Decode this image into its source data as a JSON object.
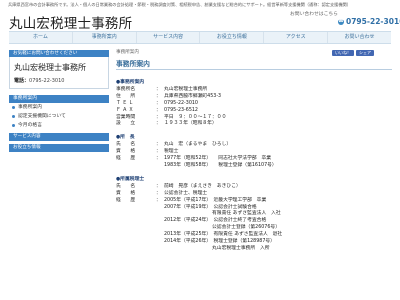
{
  "top_tagline": "兵庫県西宮市の会計事務所です。法人・個人の日常業務の会計処理・節税・税務調査対策、相続税申告、創業支援など総合的にサポート。経営革新等支援機関（通称：認定支援機関）",
  "header": {
    "title": "丸山宏税理士事務所",
    "contact_line": "お問い合わせはこちら",
    "tel_icon": "phone-icon",
    "tel": "0795-22-3010"
  },
  "nav": [
    {
      "label": "ホーム"
    },
    {
      "label": "事務所案内"
    },
    {
      "label": "サービス内容"
    },
    {
      "label": "お役立ち情報"
    },
    {
      "label": "アクセス"
    },
    {
      "label": "お問い合わせ"
    }
  ],
  "sidebar": {
    "notice": "お気軽にお問い合わせください",
    "office_name": "丸山宏税理士事務所",
    "tel_label": "電話：",
    "tel": "0795-22-3010",
    "menu_head": "事務所案内",
    "menu_items": [
      {
        "label": "事務所案内"
      },
      {
        "label": "認定支援機関について"
      },
      {
        "label": "今月の格言"
      }
    ],
    "sub_heads": [
      {
        "label": "サービス内容"
      },
      {
        "label": "お役立ち情報"
      }
    ]
  },
  "main": {
    "breadcrumb": "事務所案内",
    "fb_like": "いいね！",
    "fb_share": "シェア",
    "page_title": "事務所案内",
    "office_section": {
      "title": "●事務所案内",
      "rows": [
        {
          "label": "事務所名",
          "value": "丸山宏税理士事務所"
        },
        {
          "label": "住　　所",
          "value": "兵庫県西脇市郷瀬町453-3"
        },
        {
          "label": "Ｔ Ｅ Ｌ",
          "value": "0795-22-3010"
        },
        {
          "label": "Ｆ Ａ Ｘ",
          "value": "0795-23-6512"
        },
        {
          "label": "営業時間",
          "value": "平日　９：００～１７：００"
        },
        {
          "label": "設　　立",
          "value": "１９３３年（昭和８年）"
        }
      ]
    },
    "owner_section": {
      "title": "●所　長",
      "rows": [
        {
          "label": "氏　　名",
          "value": "丸山　宏（まるやま　ひろし）"
        },
        {
          "label": "資　　格",
          "value": "税理士"
        },
        {
          "label": "経　　歴",
          "value": "1977年（昭和52年）　　同志社大学法学部　卒業"
        },
        {
          "label": "",
          "value": "1983年（昭和58年）　　税理士登録（第16107号）"
        }
      ]
    },
    "staff_section": {
      "title": "●所属税理士",
      "rows": [
        {
          "label": "氏　　名",
          "value": "前崎　晃彦（まえさき　あきひこ）"
        },
        {
          "label": "資　　格",
          "value": "公認会計士、税理士"
        },
        {
          "label": "経　　歴",
          "value": "2005年（平成17年）　近畿大学理工学部　卒業"
        },
        {
          "label": "",
          "value": "2007年（平成19年）　公認会計士試験合格"
        },
        {
          "label": "",
          "value": "　　　　　　　　　　有限責任 あずさ監査法人　入社"
        },
        {
          "label": "",
          "value": "2012年（平成24年）　公認会計士終了考査合格"
        },
        {
          "label": "",
          "value": "　　　　　　　　　　公認会計士登録（第26076号）"
        },
        {
          "label": "",
          "value": "2013年（平成25年）　有限責任 あずさ監査法人　退社"
        },
        {
          "label": "",
          "value": "2014年（平成26年）　税理士登録（第128987号）"
        },
        {
          "label": "",
          "value": "　　　　　　　　　　丸山宏税理士事務所　入所"
        }
      ]
    }
  }
}
